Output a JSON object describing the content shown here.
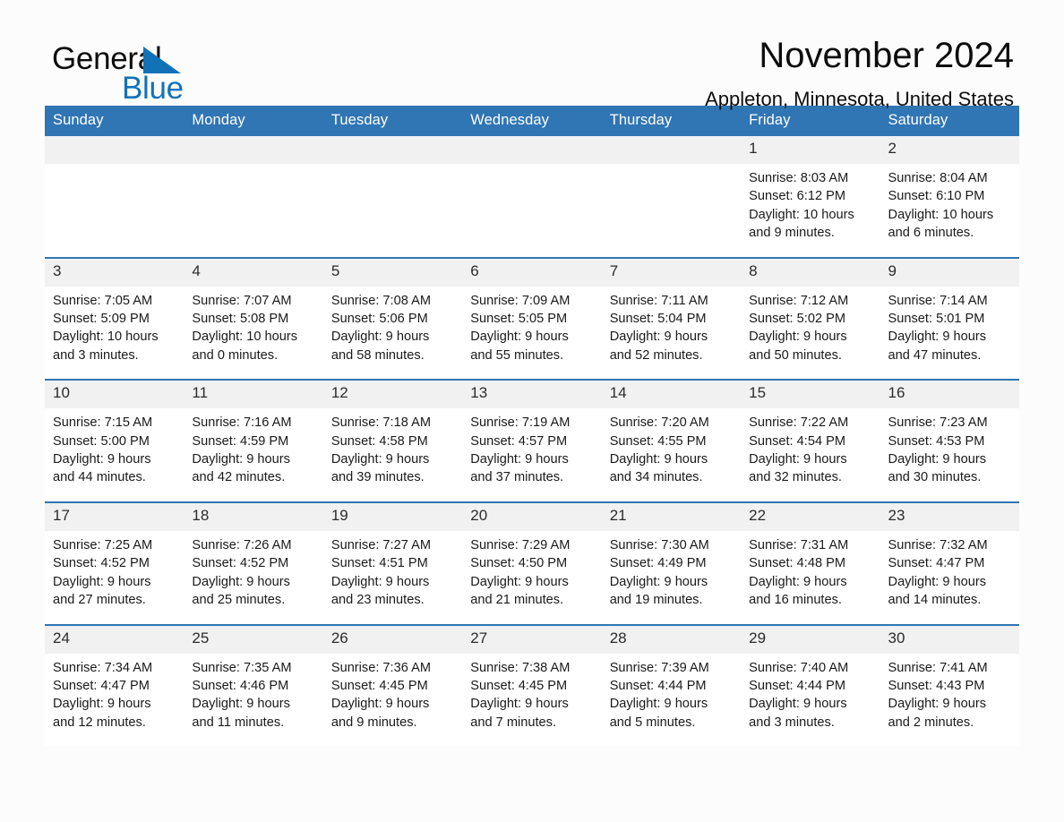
{
  "brand": {
    "name_part1": "General",
    "name_part2": "Blue",
    "accent_color": "#1272b8"
  },
  "header": {
    "title": "November 2024",
    "subtitle": "Appleton, Minnesota, United States",
    "header_bg_color": "#3075b4",
    "daynum_bg_color": "#f1f1f1"
  },
  "weekday_headers": [
    "Sunday",
    "Monday",
    "Tuesday",
    "Wednesday",
    "Thursday",
    "Friday",
    "Saturday"
  ],
  "labels": {
    "sunrise_prefix": "Sunrise:",
    "sunset_prefix": "Sunset:",
    "daylight_prefix": "Daylight:"
  },
  "weeks": [
    [
      {
        "day": "",
        "lines": []
      },
      {
        "day": "",
        "lines": []
      },
      {
        "day": "",
        "lines": []
      },
      {
        "day": "",
        "lines": []
      },
      {
        "day": "",
        "lines": []
      },
      {
        "day": "1",
        "lines": [
          "Sunrise: 8:03 AM",
          "Sunset: 6:12 PM",
          "Daylight: 10 hours",
          "and 9 minutes."
        ]
      },
      {
        "day": "2",
        "lines": [
          "Sunrise: 8:04 AM",
          "Sunset: 6:10 PM",
          "Daylight: 10 hours",
          "and 6 minutes."
        ]
      }
    ],
    [
      {
        "day": "3",
        "lines": [
          "Sunrise: 7:05 AM",
          "Sunset: 5:09 PM",
          "Daylight: 10 hours",
          "and 3 minutes."
        ]
      },
      {
        "day": "4",
        "lines": [
          "Sunrise: 7:07 AM",
          "Sunset: 5:08 PM",
          "Daylight: 10 hours",
          "and 0 minutes."
        ]
      },
      {
        "day": "5",
        "lines": [
          "Sunrise: 7:08 AM",
          "Sunset: 5:06 PM",
          "Daylight: 9 hours",
          "and 58 minutes."
        ]
      },
      {
        "day": "6",
        "lines": [
          "Sunrise: 7:09 AM",
          "Sunset: 5:05 PM",
          "Daylight: 9 hours",
          "and 55 minutes."
        ]
      },
      {
        "day": "7",
        "lines": [
          "Sunrise: 7:11 AM",
          "Sunset: 5:04 PM",
          "Daylight: 9 hours",
          "and 52 minutes."
        ]
      },
      {
        "day": "8",
        "lines": [
          "Sunrise: 7:12 AM",
          "Sunset: 5:02 PM",
          "Daylight: 9 hours",
          "and 50 minutes."
        ]
      },
      {
        "day": "9",
        "lines": [
          "Sunrise: 7:14 AM",
          "Sunset: 5:01 PM",
          "Daylight: 9 hours",
          "and 47 minutes."
        ]
      }
    ],
    [
      {
        "day": "10",
        "lines": [
          "Sunrise: 7:15 AM",
          "Sunset: 5:00 PM",
          "Daylight: 9 hours",
          "and 44 minutes."
        ]
      },
      {
        "day": "11",
        "lines": [
          "Sunrise: 7:16 AM",
          "Sunset: 4:59 PM",
          "Daylight: 9 hours",
          "and 42 minutes."
        ]
      },
      {
        "day": "12",
        "lines": [
          "Sunrise: 7:18 AM",
          "Sunset: 4:58 PM",
          "Daylight: 9 hours",
          "and 39 minutes."
        ]
      },
      {
        "day": "13",
        "lines": [
          "Sunrise: 7:19 AM",
          "Sunset: 4:57 PM",
          "Daylight: 9 hours",
          "and 37 minutes."
        ]
      },
      {
        "day": "14",
        "lines": [
          "Sunrise: 7:20 AM",
          "Sunset: 4:55 PM",
          "Daylight: 9 hours",
          "and 34 minutes."
        ]
      },
      {
        "day": "15",
        "lines": [
          "Sunrise: 7:22 AM",
          "Sunset: 4:54 PM",
          "Daylight: 9 hours",
          "and 32 minutes."
        ]
      },
      {
        "day": "16",
        "lines": [
          "Sunrise: 7:23 AM",
          "Sunset: 4:53 PM",
          "Daylight: 9 hours",
          "and 30 minutes."
        ]
      }
    ],
    [
      {
        "day": "17",
        "lines": [
          "Sunrise: 7:25 AM",
          "Sunset: 4:52 PM",
          "Daylight: 9 hours",
          "and 27 minutes."
        ]
      },
      {
        "day": "18",
        "lines": [
          "Sunrise: 7:26 AM",
          "Sunset: 4:52 PM",
          "Daylight: 9 hours",
          "and 25 minutes."
        ]
      },
      {
        "day": "19",
        "lines": [
          "Sunrise: 7:27 AM",
          "Sunset: 4:51 PM",
          "Daylight: 9 hours",
          "and 23 minutes."
        ]
      },
      {
        "day": "20",
        "lines": [
          "Sunrise: 7:29 AM",
          "Sunset: 4:50 PM",
          "Daylight: 9 hours",
          "and 21 minutes."
        ]
      },
      {
        "day": "21",
        "lines": [
          "Sunrise: 7:30 AM",
          "Sunset: 4:49 PM",
          "Daylight: 9 hours",
          "and 19 minutes."
        ]
      },
      {
        "day": "22",
        "lines": [
          "Sunrise: 7:31 AM",
          "Sunset: 4:48 PM",
          "Daylight: 9 hours",
          "and 16 minutes."
        ]
      },
      {
        "day": "23",
        "lines": [
          "Sunrise: 7:32 AM",
          "Sunset: 4:47 PM",
          "Daylight: 9 hours",
          "and 14 minutes."
        ]
      }
    ],
    [
      {
        "day": "24",
        "lines": [
          "Sunrise: 7:34 AM",
          "Sunset: 4:47 PM",
          "Daylight: 9 hours",
          "and 12 minutes."
        ]
      },
      {
        "day": "25",
        "lines": [
          "Sunrise: 7:35 AM",
          "Sunset: 4:46 PM",
          "Daylight: 9 hours",
          "and 11 minutes."
        ]
      },
      {
        "day": "26",
        "lines": [
          "Sunrise: 7:36 AM",
          "Sunset: 4:45 PM",
          "Daylight: 9 hours",
          "and 9 minutes."
        ]
      },
      {
        "day": "27",
        "lines": [
          "Sunrise: 7:38 AM",
          "Sunset: 4:45 PM",
          "Daylight: 9 hours",
          "and 7 minutes."
        ]
      },
      {
        "day": "28",
        "lines": [
          "Sunrise: 7:39 AM",
          "Sunset: 4:44 PM",
          "Daylight: 9 hours",
          "and 5 minutes."
        ]
      },
      {
        "day": "29",
        "lines": [
          "Sunrise: 7:40 AM",
          "Sunset: 4:44 PM",
          "Daylight: 9 hours",
          "and 3 minutes."
        ]
      },
      {
        "day": "30",
        "lines": [
          "Sunrise: 7:41 AM",
          "Sunset: 4:43 PM",
          "Daylight: 9 hours",
          "and 2 minutes."
        ]
      }
    ]
  ]
}
